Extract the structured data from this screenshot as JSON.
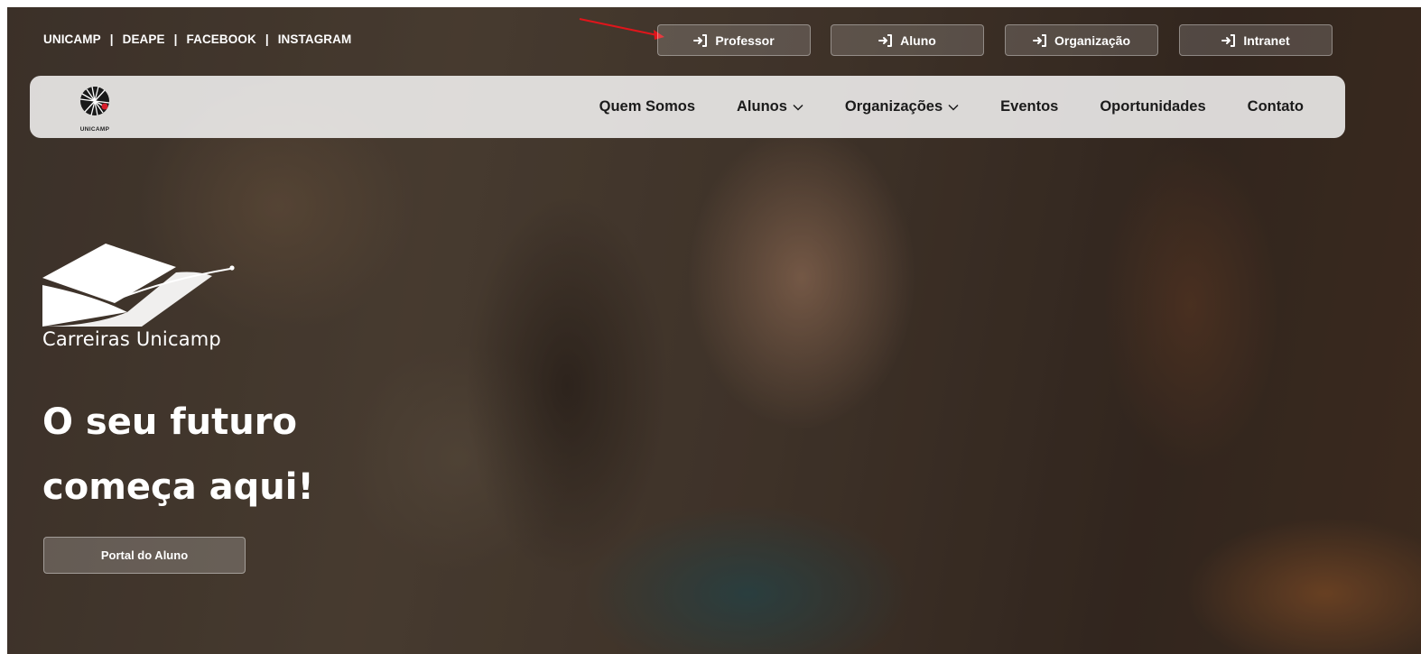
{
  "top_links": {
    "unicamp": "UNICAMP",
    "deape": "DEAPE",
    "facebook": "FACEBOOK",
    "instagram": "INSTAGRAM",
    "separator": "|"
  },
  "login_buttons": {
    "professor": "Professor",
    "aluno": "Aluno",
    "organizacao": "Organização",
    "intranet": "Intranet",
    "icon": "sign-in-icon"
  },
  "navbar": {
    "logo_text": "UNICAMP",
    "items": {
      "quem_somos": "Quem Somos",
      "alunos": "Alunos",
      "organizacoes": "Organizações",
      "eventos": "Eventos",
      "oportunidades": "Oportunidades",
      "contato": "Contato"
    }
  },
  "hero": {
    "brand_name": "Carreiras Unicamp",
    "headline_line1": "O seu futuro",
    "headline_line2": "começa aqui!",
    "portal_button": "Portal do Aluno"
  },
  "colors": {
    "annotation_arrow": "#e0151b",
    "text_light": "#ffffff",
    "nav_text": "#1b1b1b"
  }
}
